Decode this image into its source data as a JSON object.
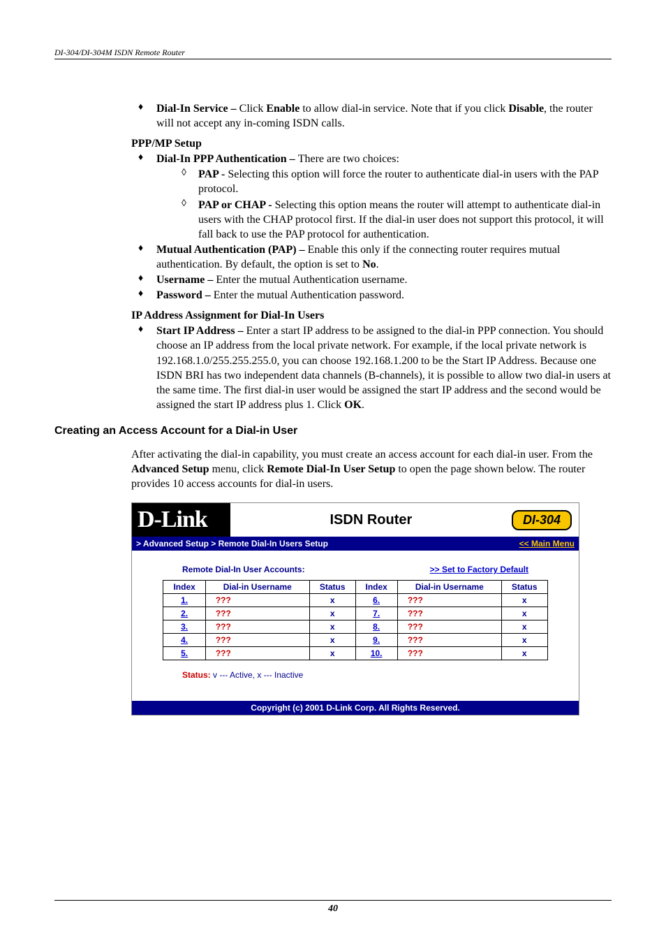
{
  "header": {
    "text": "DI-304/DI-304M ISDN Remote Router"
  },
  "section_dialin": {
    "label": "Dial-In Service – ",
    "text_before_enable": "Click ",
    "enable": "Enable",
    "text_after_enable": " to allow dial-in service. Note that if you click ",
    "disable": "Disable",
    "text_after_disable": ", the router will not accept any in-coming ISDN calls."
  },
  "ppp": {
    "heading": "PPP/MP Setup",
    "ppp_auth": {
      "label": "Dial-In PPP Authentication – ",
      "rest": "There are two choices:"
    },
    "pap": {
      "label": "PAP - ",
      "text": "Selecting this option will force the router to authenticate dial-in users with the PAP protocol."
    },
    "pap_chap": {
      "label": "PAP or CHAP - ",
      "text": "Selecting this option means the router will attempt to authenticate dial-in users with the CHAP protocol first. If the dial-in user does not support this protocol, it will fall back to use the PAP protocol for authentication."
    },
    "mutual": {
      "label": "Mutual Authentication (PAP) – ",
      "text_before": "Enable this only if the connecting router requires mutual authentication. By default, the option is set to ",
      "no": "No",
      "period": "."
    },
    "username": {
      "label": "Username – ",
      "text": "Enter the mutual Authentication username."
    },
    "password": {
      "label": "Password – ",
      "text": "Enter the mutual Authentication password."
    }
  },
  "ip": {
    "heading": "IP Address Assignment for Dial-In Users",
    "startip": {
      "label": "Start IP Address – ",
      "text_before": "Enter a start IP address to be assigned to the dial-in PPP connection. You should choose an IP address from the local private network. For example, if the local private network is 192.168.1.0/255.255.255.0, you can choose 192.168.1.200 to be the Start IP Address. Because one ISDN BRI has two independent data channels (B-channels), it is possible to allow two dial-in users at the same time. The first dial-in user would be assigned the start IP address and the second would be assigned the start IP address plus 1. Click ",
      "ok": "OK",
      "period": "."
    }
  },
  "h2": "Creating an Access Account for a Dial-in User",
  "para": {
    "t1": "After activating the dial-in capability, you must create an access account for each dial-in user. From the ",
    "adv": "Advanced Setup",
    "t2": " menu, click ",
    "remote": "Remote Dial-In User Setup",
    "t3": " to open the page shown below. The router provides 10 access accounts for dial-in users."
  },
  "router": {
    "logo": "D-Link",
    "title": "ISDN Router",
    "badge": "DI-304",
    "crumb": "> Advanced Setup > Remote Dial-In Users Setup",
    "mainmenu": "<< Main Menu",
    "accounts_title": "Remote Dial-In User Accounts:",
    "factory": ">>  Set to Factory Default",
    "headers": {
      "idx": "Index",
      "name": "Dial-in Username",
      "status": "Status"
    },
    "rows_left": [
      {
        "idx": "1.",
        "name": "???",
        "status": "x"
      },
      {
        "idx": "2.",
        "name": "???",
        "status": "x"
      },
      {
        "idx": "3.",
        "name": "???",
        "status": "x"
      },
      {
        "idx": "4.",
        "name": "???",
        "status": "x"
      },
      {
        "idx": "5.",
        "name": "???",
        "status": "x"
      }
    ],
    "rows_right": [
      {
        "idx": "6.",
        "name": "???",
        "status": "x"
      },
      {
        "idx": "7.",
        "name": "???",
        "status": "x"
      },
      {
        "idx": "8.",
        "name": "???",
        "status": "x"
      },
      {
        "idx": "9.",
        "name": "???",
        "status": "x"
      },
      {
        "idx": "10.",
        "name": "???",
        "status": "x"
      }
    ],
    "legend_label": "Status:",
    "legend_rest": " v --- Active, x --- Inactive",
    "copyright": "Copyright (c) 2001 D-Link Corp. All Rights Reserved."
  },
  "page_number": "40"
}
